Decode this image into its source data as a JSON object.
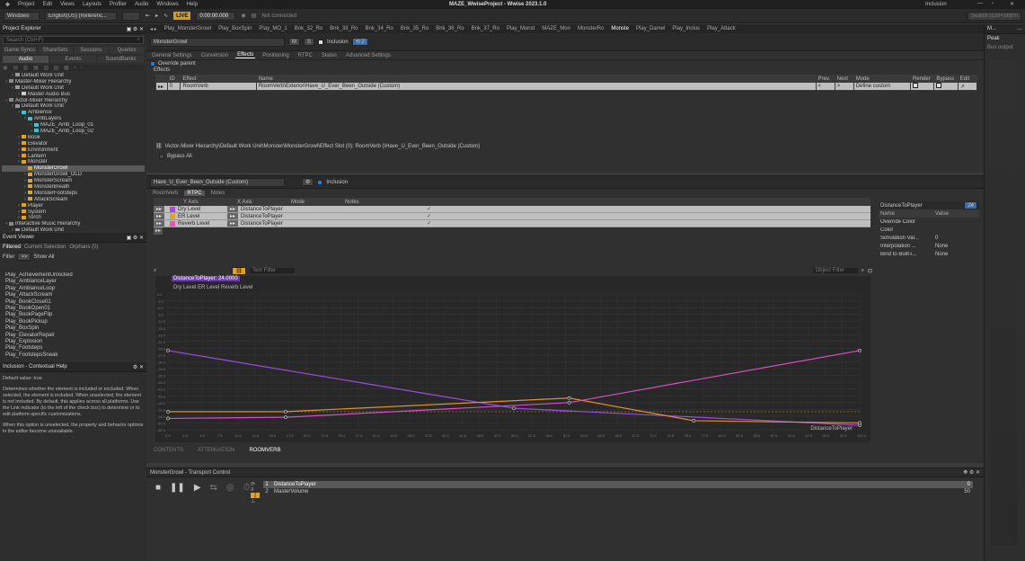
{
  "titlebar": {
    "menus": [
      "Project",
      "Edit",
      "Views",
      "Layouts",
      "Profiler",
      "Audio",
      "Windows",
      "Help"
    ],
    "title": "MAZE_WwiseProject - Wwise 2023.1.0",
    "right_label": "Inclusion"
  },
  "toolbar": {
    "layout": "Windows",
    "language": "English(US) (Referenc...",
    "live_label": "LIVE",
    "time": "0:00:00.000",
    "status": "Not connected",
    "right_search": "Search (Ctrl+Shift+F)"
  },
  "project_explorer": {
    "title": "Project Explorer",
    "search_placeholder": "Search (Ctrl+F)",
    "tabs_row1": [
      "Game Syncs",
      "ShareSets",
      "Sessions",
      "Queries"
    ],
    "tabs_row2": [
      "Audio",
      "Events",
      "SoundBanks"
    ],
    "tree": [
      {
        "label": "Default Work Unit",
        "indent": 1,
        "color": "#9a9a9a"
      },
      {
        "label": "Master-Mixer Hierarchy",
        "indent": 0,
        "color": "#888"
      },
      {
        "label": "Default Work Unit",
        "indent": 1,
        "color": "#9a9a9a"
      },
      {
        "label": "Master Audio Bus",
        "indent": 2,
        "color": "#ccc"
      },
      {
        "label": "Actor-Mixer Hierarchy",
        "indent": 0,
        "color": "#888"
      },
      {
        "label": "Default Work Unit",
        "indent": 1,
        "color": "#9a9a9a"
      },
      {
        "label": "Ambience",
        "indent": 2,
        "color": "#3cc2d6"
      },
      {
        "label": "AmbLayers",
        "indent": 3,
        "color": "#3cc2d6"
      },
      {
        "label": "MAZE_Amb_Loop_01",
        "indent": 4,
        "color": "#3cc2d6"
      },
      {
        "label": "MAZE_Amb_Loop_02",
        "indent": 4,
        "color": "#3cc2d6"
      },
      {
        "label": "Book",
        "indent": 2,
        "color": "#e0a32a"
      },
      {
        "label": "Elevator",
        "indent": 2,
        "color": "#e0a32a"
      },
      {
        "label": "Environment",
        "indent": 2,
        "color": "#e0a32a"
      },
      {
        "label": "Lantern",
        "indent": 2,
        "color": "#e0a32a"
      },
      {
        "label": "Monster",
        "indent": 2,
        "color": "#e0a32a"
      },
      {
        "label": "MonsterGrowl",
        "indent": 3,
        "color": "#e0a32a",
        "selected": true
      },
      {
        "label": "MonsterGrowl_OLD",
        "indent": 3,
        "color": "#e0a32a"
      },
      {
        "label": "MonsterScream",
        "indent": 3,
        "color": "#e0a32a"
      },
      {
        "label": "MonsterBreath",
        "indent": 3,
        "color": "#e0a32a"
      },
      {
        "label": "MonsterFootsteps",
        "indent": 3,
        "color": "#e0a32a"
      },
      {
        "label": "AttackScream",
        "indent": 3,
        "color": "#e0a32a"
      },
      {
        "label": "Player",
        "indent": 2,
        "color": "#e0a32a"
      },
      {
        "label": "System",
        "indent": 2,
        "color": "#e0a32a"
      },
      {
        "label": "Torch",
        "indent": 2,
        "color": "#e0a32a"
      },
      {
        "label": "Interactive Music Hierarchy",
        "indent": 0,
        "color": "#888"
      },
      {
        "label": "Default Work Unit",
        "indent": 1,
        "color": "#9a9a9a"
      }
    ]
  },
  "event_viewer": {
    "title": "Event Viewer",
    "tabs": [
      "Filtered",
      "Current Selection",
      "Orphans (0)"
    ],
    "filter_label": "Filter",
    "filter_value": "Show All",
    "events": [
      "Play_AchievementUnlocked",
      "Play_AmbianceLayer",
      "Play_AmbianceLoop",
      "Play_AttackScream",
      "Play_BookClose01",
      "Play_BookOpen01",
      "Play_BookPageFlip",
      "Play_BookPickup",
      "Play_BoxSpin",
      "Play_ElevatorRepair",
      "Play_Explosion",
      "Play_Footsteps",
      "Play_FootstepsSneak"
    ]
  },
  "help": {
    "title": "Inclusion - Contextual Help",
    "default_value": "Default value: true",
    "para1": "Determines whether the element is included or excluded. When selected, the element is included. When unselected, the element is not included. By default, this applies across all platforms. Use the Link indicator (to the left of the check box) to determine or to edit platform-specific customizations.",
    "para2": "When this option is unselected, the property and behavior options in the editor become unavailable."
  },
  "main_tabs": [
    {
      "label": "Play_MonsterGrowl"
    },
    {
      "label": "Play_BoxSpin"
    },
    {
      "label": "Play_MO_1"
    },
    {
      "label": "Bnk_32_Ro"
    },
    {
      "label": "Bnk_33_Ro"
    },
    {
      "label": "Bnk_34_Ro"
    },
    {
      "label": "Bnk_35_Ro"
    },
    {
      "label": "Bnk_36_Ro"
    },
    {
      "label": "Bnk_37_Ro"
    },
    {
      "label": "Play_Monst"
    },
    {
      "label": "MAZE_Mon"
    },
    {
      "label": "MonsterRo"
    },
    {
      "label": "Monste",
      "active": true
    },
    {
      "label": "Play_Damel"
    },
    {
      "label": "Play_Inclus"
    },
    {
      "label": "Play_Attack"
    }
  ],
  "editor": {
    "name": "MonsterGrowl",
    "inclusion_label": "Inclusion",
    "tabs": [
      "General Settings",
      "Conversion",
      "Effects",
      "Positioning",
      "RTPC",
      "States",
      "Advanced Settings"
    ],
    "active_tab": "Effects",
    "override_parent": "Override parent",
    "effects_label": "Effects",
    "effects_cols": [
      "ID",
      "Effect",
      "Name",
      "Prev.",
      "Next",
      "Mode",
      "Render",
      "Bypass",
      "Edit"
    ],
    "effect_row": {
      "id": "0",
      "effect": "RoomVerb",
      "name": "RoomVerb\\Exterior\\Have_U_Ever_Been_Outside (Custom)",
      "mode": "Define custom"
    },
    "path": "\\Actor-Mixer Hierarchy\\Default Work Unit\\Monster\\MonsterGrowl\\Effect Slot (0): RoomVerb (\\Have_U_Ever_Been_Outside (Custom)",
    "bypass_all": "Bypass All"
  },
  "effect_editor": {
    "name": "Have_U_Ever_Been_Outside (Custom)",
    "inclusion_label": "Inclusion",
    "tabs": [
      "RoomVerb",
      "RTPC",
      "Notes"
    ],
    "active_tab": "RTPC",
    "cols": [
      "Y Axis",
      "X Axis",
      "Mode",
      "Notes"
    ],
    "rows": [
      {
        "y": "Dry Level",
        "x": "DistanceToPlayer",
        "color": "#a64bd6"
      },
      {
        "y": "ER Level",
        "x": "DistanceToPlayer",
        "color": "#e0a32a"
      },
      {
        "y": "Reverb Level",
        "x": "DistanceToPlayer",
        "color": "#e05ab0"
      }
    ],
    "text_filter": "Text Filter",
    "object_filter": "Object Filter",
    "props_title": "DistanceToPlayer",
    "props_value": "24",
    "props": [
      {
        "name": "Name",
        "value": "Value"
      },
      {
        "name": "Override Color",
        "value": ""
      },
      {
        "name": "Color",
        "value": ""
      },
      {
        "name": "Simulation Val...",
        "value": "0"
      },
      {
        "name": "Interpolation ...",
        "value": "None"
      },
      {
        "name": "Bind to Built-i...",
        "value": "None"
      }
    ]
  },
  "graph": {
    "tag": "DistanceToPlayer: 24.0000",
    "legend": "Dry Level  ER Level  Reverb Level",
    "xaxis_label": "DistanceToPlayer",
    "bottom_tabs": [
      "CONTENTS",
      "ATTENUATION",
      "ROOMVERB"
    ],
    "active_bottom": "ROOMVERB"
  },
  "chart_data": {
    "type": "line",
    "xlim": [
      0,
      100
    ],
    "ylim": [
      -60,
      0
    ],
    "series": [
      {
        "name": "Dry Level",
        "color": "#9b4de0",
        "points": [
          [
            0,
            -25
          ],
          [
            50,
            -50.5
          ],
          [
            100,
            -58
          ]
        ]
      },
      {
        "name": "ER Level",
        "color": "#e0912a",
        "points": [
          [
            0,
            -52
          ],
          [
            17,
            -52
          ],
          [
            58,
            -46
          ],
          [
            76,
            -56
          ],
          [
            100,
            -57
          ]
        ]
      },
      {
        "name": "Reverb Level",
        "color": "#d94ec2",
        "points": [
          [
            0,
            -55
          ],
          [
            17,
            -54.5
          ],
          [
            58,
            -48
          ],
          [
            100,
            -25
          ]
        ]
      }
    ]
  },
  "transport": {
    "title": "MonsterGrowl - Transport Control",
    "items": [
      {
        "num": "1",
        "label": "DistanceToPlayer",
        "value": "0"
      },
      {
        "num": "2",
        "label": "MasterVolume",
        "value": "50"
      }
    ]
  },
  "right": {
    "title": "M...",
    "tab": "Peak",
    "label": "Bus output"
  }
}
